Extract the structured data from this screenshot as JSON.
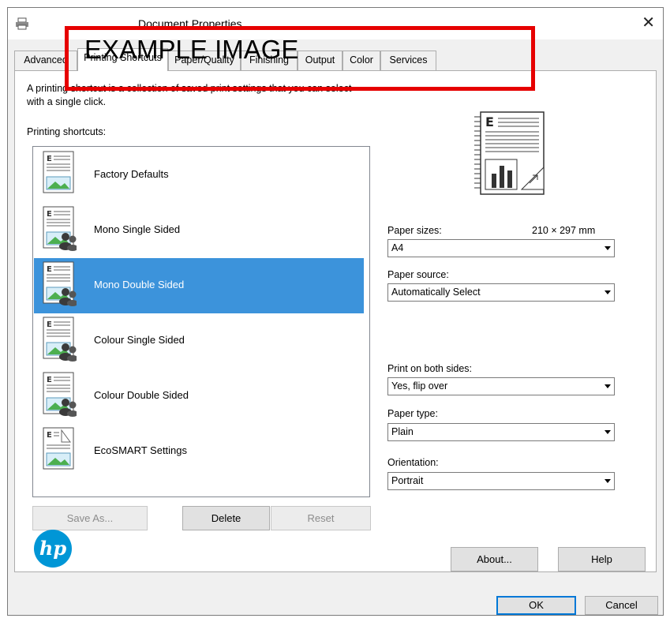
{
  "window": {
    "title": "Document Properties",
    "close_glyph": "✕",
    "icon": "printer-icon"
  },
  "overlay": {
    "text": "EXAMPLE IMAGE",
    "border_color": "#e60000"
  },
  "tabs": [
    {
      "label": "Advanced",
      "active": false
    },
    {
      "label": "Printing Shortcuts",
      "active": true
    },
    {
      "label": "Paper/Quality",
      "active": false
    },
    {
      "label": "Finishing",
      "active": false
    },
    {
      "label": "Output",
      "active": false
    },
    {
      "label": "Color",
      "active": false
    },
    {
      "label": "Services",
      "active": false
    }
  ],
  "panel": {
    "description_line1": "A printing shortcut is a collection of saved print settings that you can select",
    "description_line2": "with a single click.",
    "shortcuts_label": "Printing shortcuts:",
    "shortcuts": [
      {
        "label": "Factory Defaults",
        "selected": false,
        "badge": "none"
      },
      {
        "label": "Mono Single Sided",
        "selected": false,
        "badge": "people"
      },
      {
        "label": "Mono Double Sided",
        "selected": true,
        "badge": "people"
      },
      {
        "label": "Colour Single Sided",
        "selected": false,
        "badge": "people"
      },
      {
        "label": "Colour Double Sided",
        "selected": false,
        "badge": "people"
      },
      {
        "label": "EcoSMART Settings",
        "selected": false,
        "badge": "none"
      }
    ],
    "buttons": {
      "save_as": "Save As...",
      "delete": "Delete",
      "reset": "Reset",
      "about": "About...",
      "help": "Help"
    },
    "paper_sizes": {
      "label": "Paper sizes:",
      "value": "A4",
      "dimensions": "210 × 297 mm"
    },
    "paper_source": {
      "label": "Paper source:",
      "value": "Automatically Select"
    },
    "print_both_sides": {
      "label": "Print on both sides:",
      "value": "Yes, flip over"
    },
    "paper_type": {
      "label": "Paper type:",
      "value": "Plain"
    },
    "orientation": {
      "label": "Orientation:",
      "value": "Portrait"
    }
  },
  "footer": {
    "ok": "OK",
    "cancel": "Cancel"
  },
  "colors": {
    "selection": "#3c93db",
    "focus": "#0078d7",
    "hp_blue": "#0096d6"
  }
}
